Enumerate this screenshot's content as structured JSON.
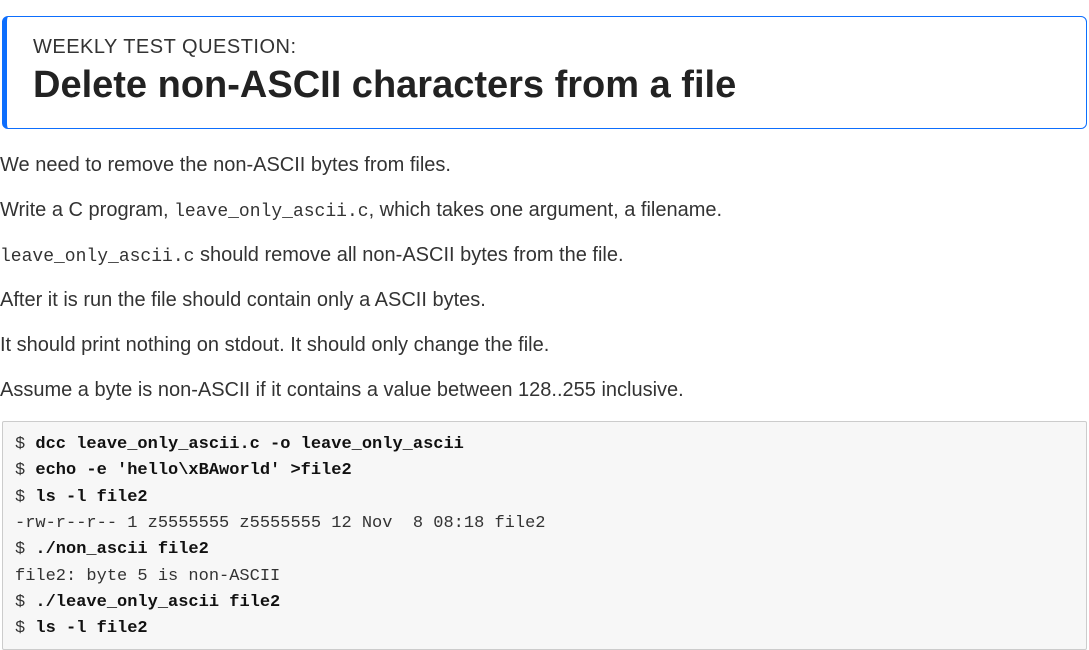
{
  "callout": {
    "overline": "WEEKLY TEST QUESTION:",
    "title": "Delete non-ASCII characters from a file"
  },
  "paragraphs": {
    "p1": "We need to remove the non-ASCII bytes from files.",
    "p2_pre": "Write a C program, ",
    "p2_code": "leave_only_ascii.c",
    "p2_post": ", which takes one argument, a filename.",
    "p3_code": "leave_only_ascii.c",
    "p3_post": " should remove all non-ASCII bytes from the file.",
    "p4": "After it is run the file should contain only a ASCII bytes.",
    "p5": "It should print nothing on stdout. It should only change the file.",
    "p6": "Assume a byte is non-ASCII if it contains a value between 128..255 inclusive."
  },
  "terminal": {
    "prompt": "$ ",
    "lines": [
      {
        "type": "cmd",
        "text": "dcc leave_only_ascii.c -o leave_only_ascii"
      },
      {
        "type": "cmd",
        "text": "echo -e 'hello\\xBAworld' >file2"
      },
      {
        "type": "cmd",
        "text": "ls -l file2"
      },
      {
        "type": "out",
        "text": "-rw-r--r-- 1 z5555555 z5555555 12 Nov  8 08:18 file2"
      },
      {
        "type": "cmd",
        "text": "./non_ascii file2"
      },
      {
        "type": "out",
        "text": "file2: byte 5 is non-ASCII"
      },
      {
        "type": "cmd",
        "text": "./leave_only_ascii file2"
      },
      {
        "type": "cmd",
        "text": "ls -l file2"
      }
    ]
  }
}
